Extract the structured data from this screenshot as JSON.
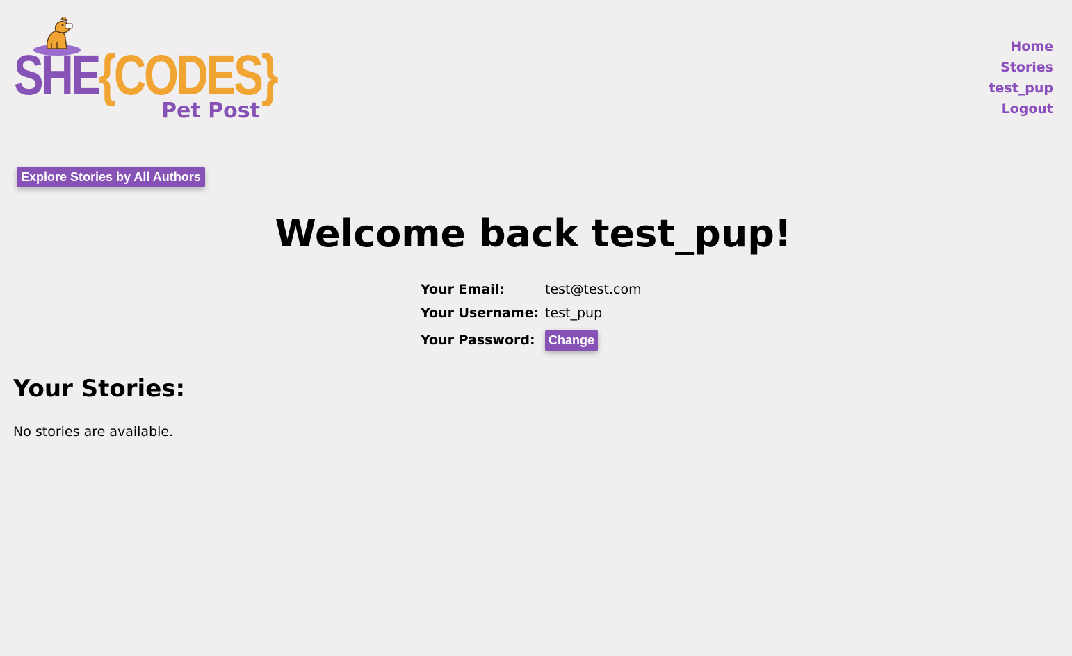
{
  "brand": {
    "logo_she": "SHE",
    "logo_codes": "{CODES}",
    "subtitle": "Pet Post",
    "colors": {
      "purple": "#8752b5",
      "orange": "#f0a431"
    }
  },
  "nav": {
    "items": [
      {
        "label": "Home"
      },
      {
        "label": "Stories"
      },
      {
        "label": "test_pup"
      },
      {
        "label": "Logout"
      }
    ]
  },
  "explore_button": {
    "label": "Explore Stories by All Authors"
  },
  "welcome": {
    "title": "Welcome back test_pup!"
  },
  "profile": {
    "email_label": "Your Email:",
    "email_value": "test@test.com",
    "username_label": "Your Username:",
    "username_value": "test_pup",
    "password_label": "Your Password:",
    "change_label": "Change"
  },
  "stories": {
    "heading": "Your Stories:",
    "empty_text": "No stories are available."
  }
}
